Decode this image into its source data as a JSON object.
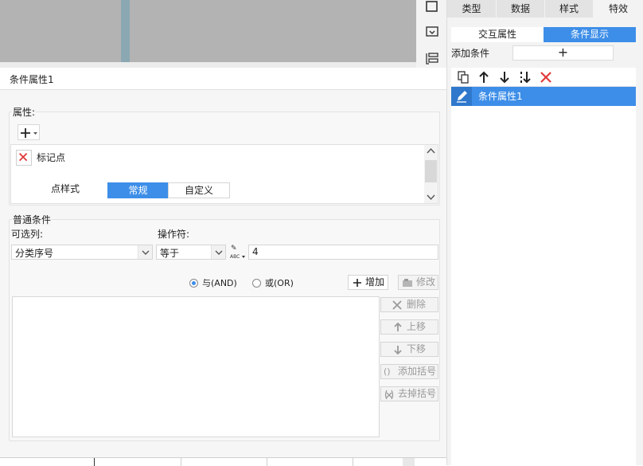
{
  "right_panel": {
    "tabs": [
      "类型",
      "数据",
      "样式",
      "特效"
    ],
    "active_tab": "特效",
    "segments": [
      "交互属性",
      "条件显示"
    ],
    "active_segment": "条件显示",
    "add_condition_label": "添加条件",
    "add_condition_button": "+",
    "list_items": [
      "条件属性1"
    ]
  },
  "dialog": {
    "title": "条件属性1",
    "attributes": {
      "group_label": "属性:",
      "item_label": "标记点",
      "point_style_label": "点样式",
      "style_options": [
        "常规",
        "自定义"
      ],
      "active_style": "常规"
    },
    "condition": {
      "group_label": "普通条件",
      "column_label": "可选列:",
      "column_value": "分类序号",
      "operator_label": "操作符:",
      "operator_value": "等于",
      "value": "4",
      "and_label": "与(AND)",
      "or_label": "或(OR)",
      "add_button": "增加",
      "modify_button": "修改",
      "delete_button": "删除",
      "move_up_button": "上移",
      "move_down_button": "下移",
      "add_bracket_button": "添加括号",
      "remove_bracket_button": "去掉括号",
      "selected_logic": "and"
    }
  },
  "colors": {
    "accent": "#3d8ee8",
    "canvas_gray": "#b3b3b3",
    "delete_red": "#e03a3a"
  }
}
